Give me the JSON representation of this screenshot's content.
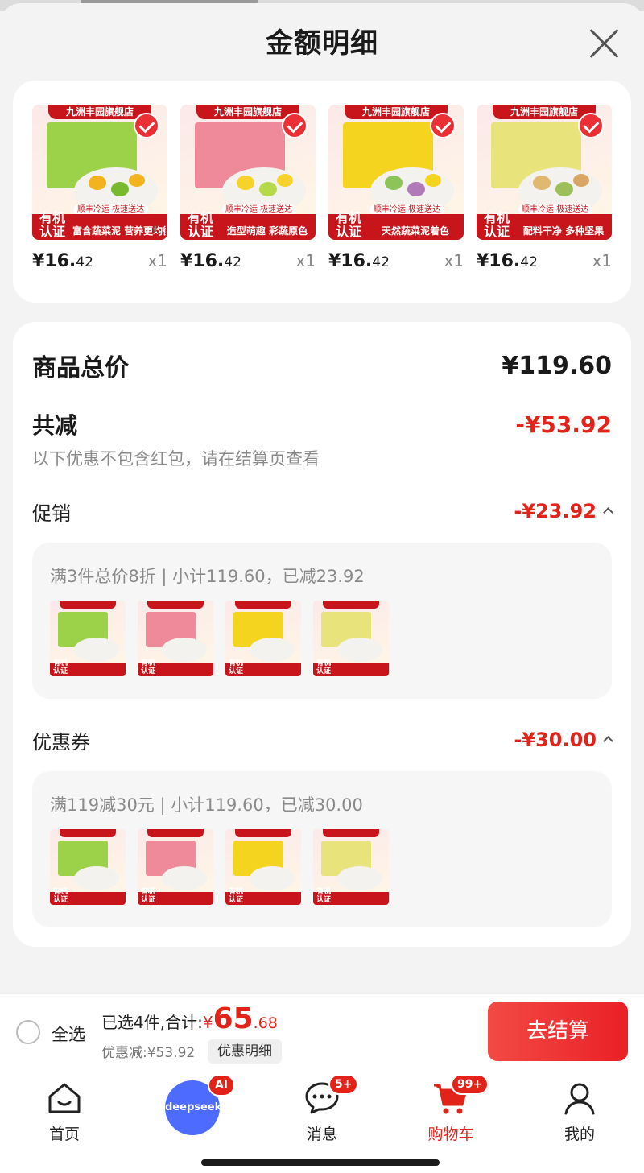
{
  "sheet": {
    "title": "金额明细",
    "close_label": ""
  },
  "products": [
    {
      "store": "九洲丰园旗舰店",
      "organic": "有机认证",
      "ship": "顺丰冷运 极速送达",
      "slogan": "富含蔬菜泥 营养更均衡",
      "price_int": "¥16.",
      "price_dec": "42",
      "qty": "x1",
      "box_color": "#9bd24a",
      "food1": "#f2b31e",
      "food2": "#79b92d",
      "food3": "#f2b31e"
    },
    {
      "store": "九洲丰园旗舰店",
      "organic": "有机认证",
      "ship": "顺丰冷运 极速送达",
      "slogan": "造型萌趣 彩蔬原色",
      "price_int": "¥16.",
      "price_dec": "42",
      "qty": "x1",
      "box_color": "#ef8a9a",
      "food1": "#f6d22a",
      "food2": "#b6d94a",
      "food3": "#f6d22a"
    },
    {
      "store": "九洲丰园旗舰店",
      "organic": "有机认证",
      "ship": "顺丰冷运 极速送达",
      "slogan": "天然蔬菜泥着色",
      "price_int": "¥16.",
      "price_dec": "42",
      "qty": "x1",
      "box_color": "#f4d41e",
      "food1": "#8cc45a",
      "food2": "#b07ab8",
      "food3": "#f4d41e"
    },
    {
      "store": "九洲丰园旗舰店",
      "organic": "有机认证",
      "ship": "顺丰冷运 极速送达",
      "slogan": "配料干净 多种坚果",
      "price_int": "¥16.",
      "price_dec": "42",
      "qty": "x1",
      "box_color": "#e8e37a",
      "food1": "#e0b872",
      "food2": "#9cbf5a",
      "food3": "#d8a565"
    }
  ],
  "summary": {
    "total_label": "商品总价",
    "total_value": "¥119.60",
    "minus_label": "共减",
    "minus_value": "-¥53.92",
    "note": "以下优惠不包含红包，请在结算页查看"
  },
  "promotion": {
    "label": "促销",
    "value": "-¥23.92",
    "rule": "满3件总价8折 | 小计119.60，已减23.92"
  },
  "coupon": {
    "label": "优惠券",
    "value": "-¥30.00",
    "rule": "满119减30元 | 小计119.60，已减30.00"
  },
  "footer": {
    "select_all": "全选",
    "selected_text": "已选4件,合计:",
    "yen": "¥",
    "total_int": "65",
    "total_dec": ".68",
    "discount_text": "优惠减:¥53.92",
    "detail_chip": "优惠明细",
    "checkout": "去结算"
  },
  "tabs": {
    "home": "首页",
    "deepseek": "deepseek",
    "ai_badge": "AI",
    "messages": "消息",
    "messages_badge": "5+",
    "cart": "购物车",
    "cart_badge": "99+",
    "mine": "我的"
  },
  "colors": {
    "accent": "#e2231a",
    "product_red": "#c8151b",
    "deepseek_blue": "#4d6bfe"
  }
}
